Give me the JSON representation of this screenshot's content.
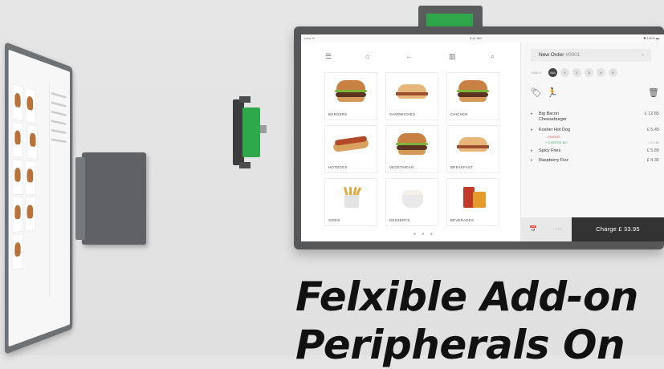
{
  "status_bar": {
    "left": "•••••• ᯤ",
    "time": "9:41 AM",
    "battery": "✱ 100% ▬"
  },
  "menu": {
    "toolbar_icons": [
      "menu-icon",
      "save-icon",
      "back-icon",
      "grid-view-icon",
      "search-icon"
    ],
    "categories": [
      {
        "label": "BURGERS",
        "icon": "burger"
      },
      {
        "label": "SANDWICHES",
        "icon": "sandwich"
      },
      {
        "label": "CHICKEN",
        "icon": "burger"
      },
      {
        "label": "HOTDOGS",
        "icon": "hotdog"
      },
      {
        "label": "VEGETARIAN",
        "icon": "burger"
      },
      {
        "label": "BREAKFAST",
        "icon": "sandwich"
      },
      {
        "label": "SIDES",
        "icon": "fries"
      },
      {
        "label": "DESSERTS",
        "icon": "dessert"
      },
      {
        "label": "BEVERAGES",
        "icon": "beverage"
      }
    ],
    "pager": "● ● ●"
  },
  "order": {
    "title": "New Order",
    "number": "#0001",
    "table_label": "TABLE",
    "tables": [
      "N/A",
      "1",
      "2",
      "3",
      "4",
      "5"
    ],
    "action_icons": [
      "discount-tag-icon",
      "takeaway-runner-icon",
      "trash-icon"
    ],
    "items": [
      {
        "name": "Big Bacon",
        "name2": "Cheeseburger",
        "price": "£ 12.85"
      },
      {
        "name": "Kosher Hot Dog",
        "name2": "",
        "price": "£ 5.45",
        "mods": [
          {
            "text": "- ONIONS",
            "type": "remove",
            "price": ""
          },
          {
            "text": "+ CHEESE BO",
            "type": "add",
            "price": "+ £ 0.50"
          }
        ]
      },
      {
        "name": "Spicy Fries",
        "name2": "",
        "price": "£ 5.80"
      },
      {
        "name": "Raspberry Fizz",
        "name2": "",
        "price": "£ 4.35"
      }
    ],
    "footer": {
      "calendar_icon": "📅",
      "more": "···",
      "charge": "Charge £ 33.95"
    }
  },
  "caption": {
    "line1": "Felxible Add-on",
    "line2": "Peripherals On"
  },
  "colors": {
    "accent_green": "#2ea84b",
    "device_grey": "#555759",
    "charge_bg": "#333333"
  }
}
